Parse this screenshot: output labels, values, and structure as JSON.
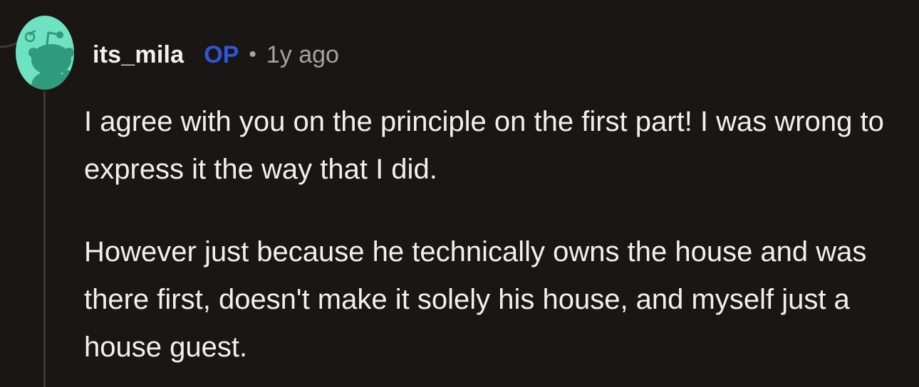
{
  "comment": {
    "author": "its_mila",
    "badge": "OP",
    "separator": "•",
    "timestamp": "1y ago",
    "paragraphs": [
      "I agree with you on the principle on the first part! I was wrong to express it the way that I did.",
      "However just because he technically owns the house and was there first, doesn't make it solely his house, and myself just a house guest."
    ]
  },
  "colors": {
    "background": "#1a1614",
    "text": "#f2f0ee",
    "op_badge": "#2f56d6",
    "muted": "#a7a29f",
    "avatar_bg": "#6fe3c1",
    "snoo_body": "#2f9a7c",
    "thread_line": "#3b3836"
  },
  "icons": {
    "avatar": "snoo-avatar-icon"
  }
}
